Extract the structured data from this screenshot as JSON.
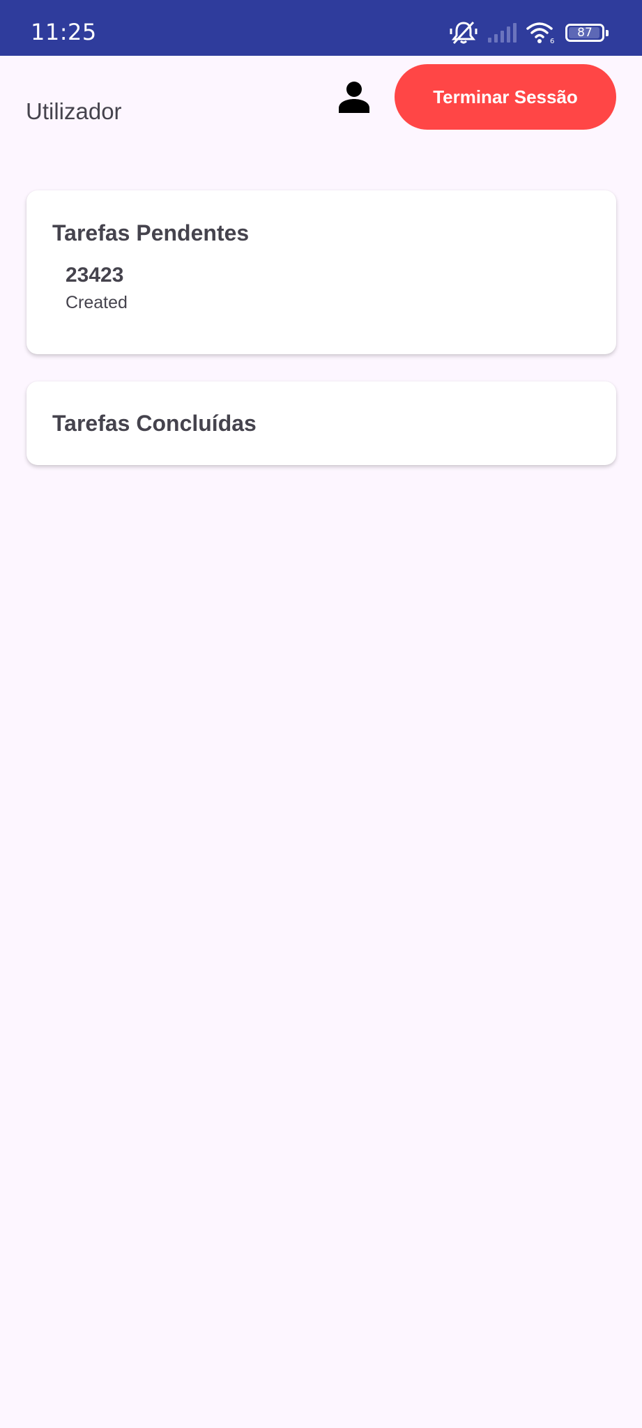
{
  "status_bar": {
    "time": "11:25",
    "battery_level": "87",
    "icons": [
      "mute-vibrate-icon",
      "signal-icon",
      "wifi-icon",
      "battery-icon"
    ]
  },
  "header": {
    "user_label": "Utilizador",
    "profile_icon": "person-icon",
    "logout_label": "Terminar Sessão"
  },
  "pending": {
    "title": "Tarefas Pendentes",
    "tasks": [
      {
        "name": "23423",
        "status": "Created"
      }
    ]
  },
  "completed": {
    "title": "Tarefas Concluídas",
    "tasks": []
  },
  "colors": {
    "status_bar": "#2f3c9c",
    "background": "#fdf6ff",
    "logout_button": "#ff4646",
    "text": "#45434d",
    "card": "#ffffff"
  }
}
